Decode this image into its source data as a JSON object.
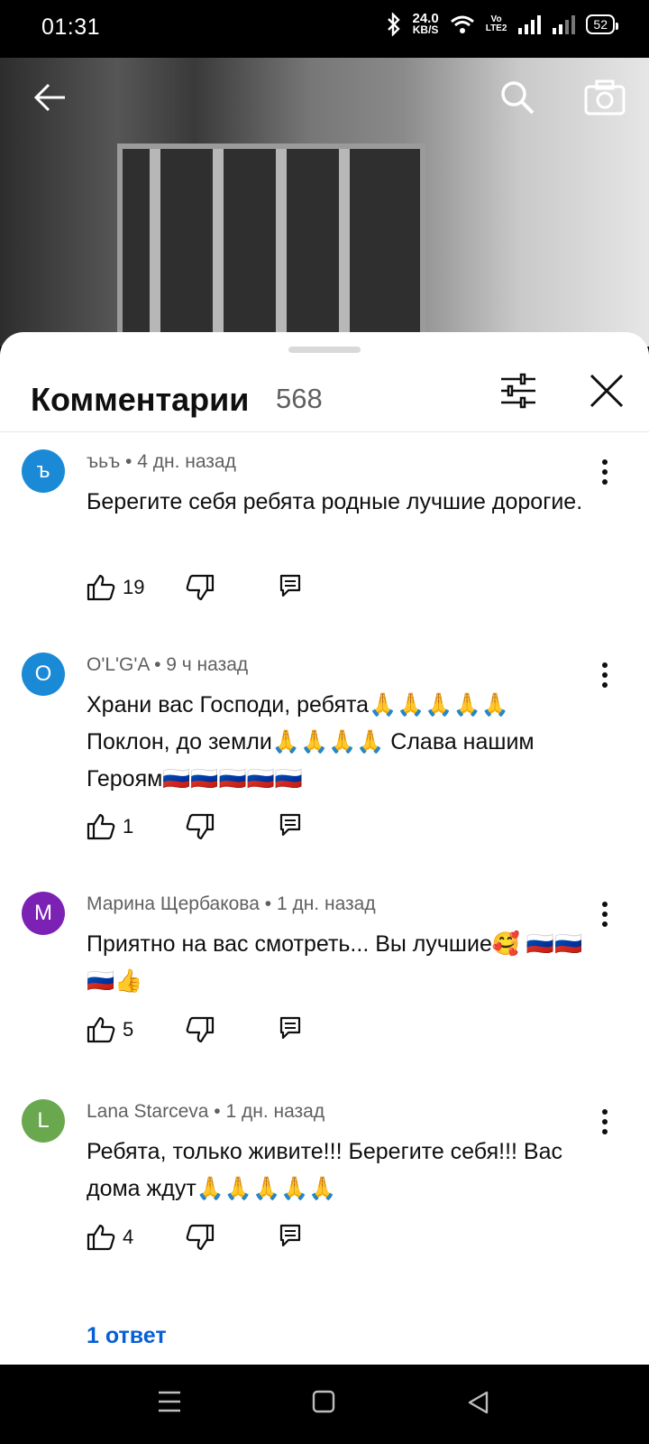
{
  "status_bar": {
    "time": "01:31",
    "net_speed_value": "24.0",
    "net_speed_unit": "KB/S",
    "volte_top": "Vo",
    "volte_bottom": "LTE2",
    "battery": "52"
  },
  "video": {
    "back_icon": "arrow-back-icon",
    "search_icon": "search-icon",
    "camera_icon": "camera-icon"
  },
  "comments_panel": {
    "title": "Комментарии",
    "count": "568",
    "filter_icon": "sliders-icon",
    "close_icon": "close-icon",
    "comments": [
      {
        "avatar_letter": "ъ",
        "avatar_color": "#1a8ad6",
        "author": "ъьъ",
        "time": "4 дн. назад",
        "text": "Берегите себя ребята родные лучшие дорогие.",
        "likes": "19"
      },
      {
        "avatar_letter": "O",
        "avatar_color": "#1a8ad6",
        "author": "O'L'G'A",
        "time": "9 ч назад",
        "text": "Храни вас Господи, ребята🙏🙏🙏🙏🙏 Поклон, до земли🙏🙏🙏🙏 Слава нашим Героям🇷🇺🇷🇺🇷🇺🇷🇺🇷🇺",
        "likes": "1"
      },
      {
        "avatar_letter": "M",
        "avatar_color": "#7b22b5",
        "author": "Марина Щербакова",
        "time": "1 дн. назад",
        "text": "Приятно на вас смотреть... Вы лучшие🥰 🇷🇺🇷🇺🇷🇺👍",
        "likes": "5"
      },
      {
        "avatar_letter": "L",
        "avatar_color": "#6aa84f",
        "author": "Lana Starceva",
        "time": "1 дн. назад",
        "text": "Ребята, только живите!!! Берегите себя!!! Вас дома ждут🙏🙏🙏🙏🙏",
        "likes": "4"
      }
    ],
    "reply_link": "1 ответ"
  },
  "nav_bar": {
    "menu_icon": "menu-icon",
    "home_icon": "home-square-icon",
    "back_icon": "back-triangle-icon"
  }
}
